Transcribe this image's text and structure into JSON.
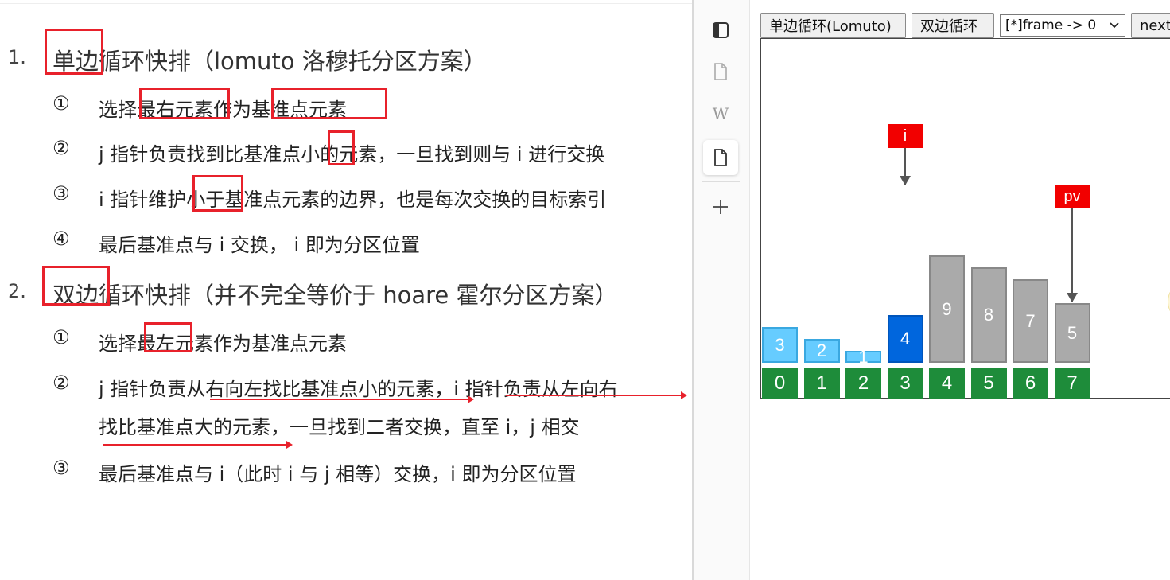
{
  "doc": {
    "sections": [
      {
        "number": "1.",
        "title": "单边循环快排（lomuto 洛穆托分区方案）",
        "items": [
          {
            "mark": "①",
            "text": "选择最右元素作为基准点元素"
          },
          {
            "mark": "②",
            "text": "j 指针负责找到比基准点小的元素，一旦找到则与 i 进行交换"
          },
          {
            "mark": "③",
            "text": "i 指针维护小于基准点元素的边界，也是每次交换的目标索引"
          },
          {
            "mark": "④",
            "text": "最后基准点与 i 交换， i 即为分区位置"
          }
        ]
      },
      {
        "number": "2.",
        "title": "双边循环快排（并不完全等价于 hoare 霍尔分区方案）",
        "items": [
          {
            "mark": "①",
            "text": "选择最左元素作为基准点元素"
          },
          {
            "mark": "②",
            "text": "j 指针负责从右向左找比基准点小的元素，i 指针负责从左向右",
            "text2": "找比基准点大的元素，一旦找到二者交换，直至 i，j 相交"
          },
          {
            "mark": "③",
            "text": "最后基准点与 i（此时 i 与 j 相等）交换，i 即为分区位置"
          }
        ]
      }
    ]
  },
  "sidebar": {
    "icons": [
      "panel-icon",
      "file-icon",
      "wikipedia-icon",
      "file-active-icon",
      "plus-icon"
    ],
    "wiki_glyph": "W"
  },
  "toolbar": {
    "lomuto_label": "单边循环(Lomuto)",
    "hoare_label": "双边循环",
    "frame_select_value": "[*]frame -> 0",
    "next_label": "next"
  },
  "visualization": {
    "values": [
      3,
      2,
      1,
      4,
      9,
      8,
      7,
      5
    ],
    "indices": [
      "0",
      "1",
      "2",
      "3",
      "4",
      "5",
      "6",
      "7"
    ],
    "bar_states": [
      "light",
      "light",
      "light",
      "current",
      "gray",
      "gray",
      "gray",
      "gray"
    ],
    "pointer_i": {
      "label": "i",
      "index": 3
    },
    "pointer_pv": {
      "label": "pv",
      "index": 7
    },
    "colors": {
      "light": "#66ccff",
      "current": "#0066dd",
      "gray": "#aaaaaa",
      "index_bg": "#1e8c3a",
      "pointer": "#f20000",
      "highlight": "#e8212b"
    }
  }
}
